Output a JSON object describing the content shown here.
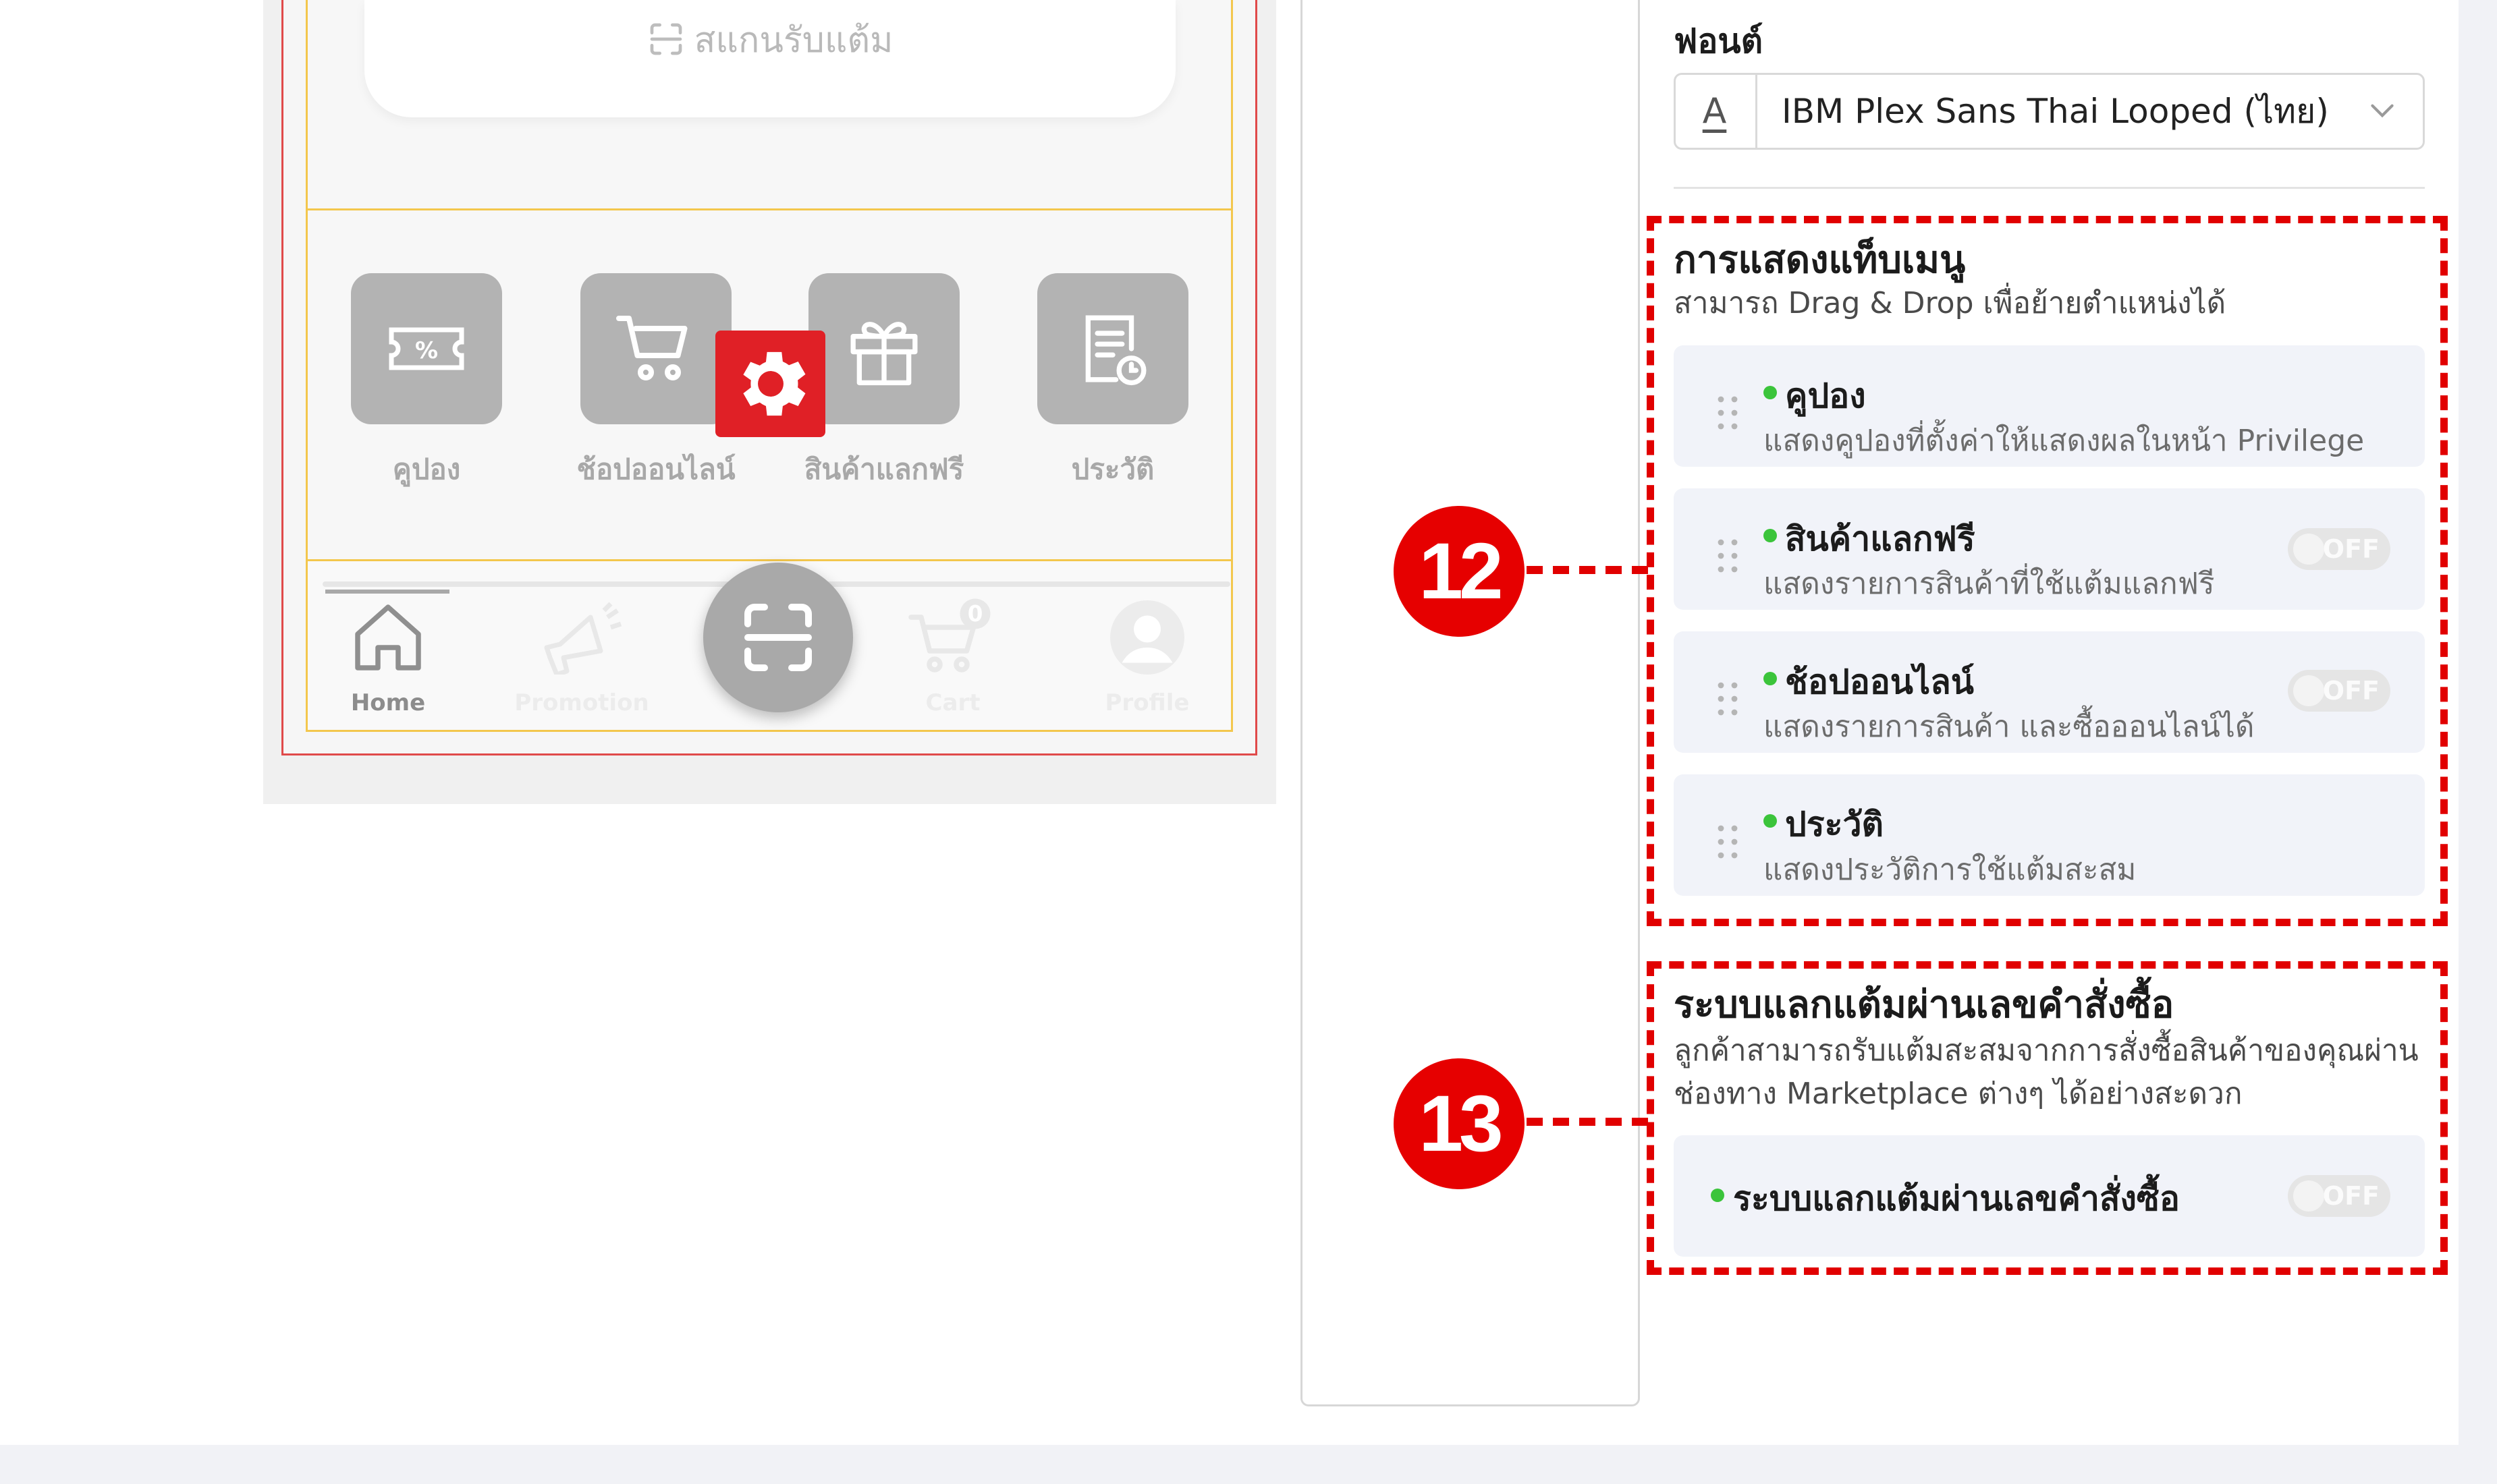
{
  "phone_preview": {
    "scan_card_label": "สแกนรับแต้ม",
    "menu_tiles": [
      {
        "label": "คูปอง",
        "icon": "coupon-icon"
      },
      {
        "label": "ช้อปออนไลน์",
        "icon": "cart-icon"
      },
      {
        "label": "สินค้าแลกฟรี",
        "icon": "gift-icon"
      },
      {
        "label": "ประวัติ",
        "icon": "history-icon"
      }
    ],
    "settings_badge_icon": "gear-icon",
    "bottom_nav": [
      {
        "label": "Home",
        "icon": "home-icon",
        "active": true
      },
      {
        "label": "Promotion",
        "icon": "megaphone-icon",
        "active": false
      },
      {
        "label": "",
        "icon": "scan-icon",
        "active": false
      },
      {
        "label": "Cart",
        "icon": "cart-icon",
        "badge": "0",
        "active": false
      },
      {
        "label": "Profile",
        "icon": "profile-icon",
        "active": false
      }
    ]
  },
  "settings": {
    "font": {
      "title": "ฟอนต์",
      "prefix_icon": "A",
      "value": "IBM Plex Sans Thai Looped (ไทย)"
    },
    "tab_menu": {
      "callout": "12",
      "title": "การแสดงแท็บเมนู",
      "description": "สามารถ Drag & Drop เพื่อย้ายตำแหน่งได้",
      "items": [
        {
          "title": "คูปอง",
          "description": "แสดงคูปองที่ตั้งค่าให้แสดงผลในหน้า Privilege",
          "toggle": null
        },
        {
          "title": "สินค้าแลกฟรี",
          "description": "แสดงรายการสินค้าที่ใช้แต้มแลกฟรี",
          "toggle": "OFF"
        },
        {
          "title": "ช้อปออนไลน์",
          "description": "แสดงรายการสินค้า และซื้อออนไลน์ได้",
          "toggle": "OFF"
        },
        {
          "title": "ประวัติ",
          "description": "แสดงประวัติการใช้แต้มสะสม",
          "toggle": null
        }
      ]
    },
    "order_redeem": {
      "callout": "13",
      "title": "ระบบแลกแต้มผ่านเลขคำสั่งซื้อ",
      "description_line1": "ลูกค้าสามารถรับแต้มสะสมจากการสั่งซื้อสินค้าของคุณผ่าน",
      "description_line2": "ช่องทาง Marketplace ต่างๆ ได้อย่างสะดวก",
      "item_title": "ระบบแลกแต้มผ่านเลขคำสั่งซื้อ",
      "toggle": "OFF"
    }
  },
  "colors": {
    "highlight_red": "#e10000",
    "callout_red": "#e60000",
    "status_green": "#3bc43b",
    "preview_border_yellow": "#f3c74d",
    "preview_border_red": "#e04a4a",
    "gear_badge_red": "#e02026"
  }
}
